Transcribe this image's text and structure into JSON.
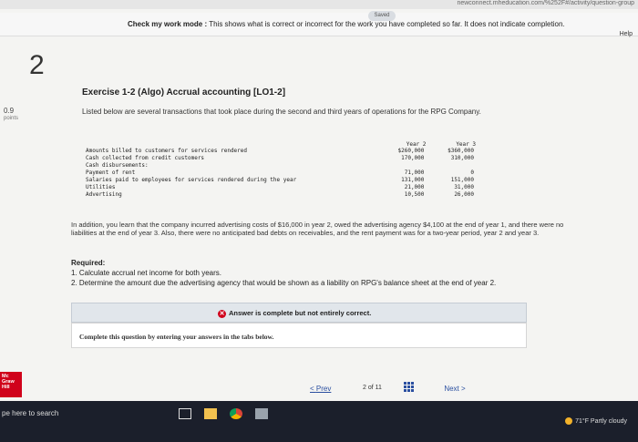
{
  "browser": {
    "url": "newconnect.mheducation.com/%252F#/activity/question-group",
    "saved_label": "Saved",
    "help_label": "Help"
  },
  "banner": {
    "mode_label": "Check my work mode :",
    "message": "This shows what is correct or incorrect for the work you have completed so far. It does not indicate completion."
  },
  "question": {
    "number": "2",
    "points": "0.9",
    "points_label": "points"
  },
  "exercise": {
    "title": "Exercise 1-2 (Algo) Accrual accounting [LO1-2]",
    "intro": "Listed below are several transactions that took place during the second and third years of operations for the RPG Company."
  },
  "transactions": {
    "headers": [
      "",
      "Year 2",
      "Year 3"
    ],
    "rows": [
      {
        "label": "Amounts billed to customers for services rendered",
        "y2": "$260,000",
        "y3": "$360,000"
      },
      {
        "label": "Cash collected from credit customers",
        "y2": "170,000",
        "y3": "310,000"
      },
      {
        "label": "Cash disbursements:",
        "y2": "",
        "y3": ""
      },
      {
        "label": "Payment of rent",
        "y2": "71,000",
        "y3": "0"
      },
      {
        "label": "Salaries paid to employees for services rendered during the year",
        "y2": "131,000",
        "y3": "151,000"
      },
      {
        "label": "Utilities",
        "y2": "21,000",
        "y3": "31,000"
      },
      {
        "label": "Advertising",
        "y2": "10,500",
        "y3": "26,000"
      }
    ]
  },
  "paragraph": "In addition, you learn that the company incurred advertising costs of $16,000 in year 2, owed the advertising agency $4,100 at the end of year 1, and there were no liabilities at the end of year 3. Also, there were no anticipated bad debts on receivables, and the rent payment was for a two-year period, year 2 and year 3.",
  "required": {
    "title": "Required:",
    "items": [
      "1. Calculate accrual net income for both years.",
      "2. Determine the amount due the advertising agency that would be shown as a liability on RPG's balance sheet at the end of year 2."
    ]
  },
  "answer": {
    "status": "Answer is complete but not entirely correct.",
    "instruction": "Complete this question by entering your answers in the tabs below."
  },
  "navigation": {
    "prev_label": "Prev",
    "page_current": "2",
    "page_of": "of",
    "page_total": "11",
    "next_label": "Next"
  },
  "logo": {
    "text": "Mc Graw Hill"
  },
  "taskbar": {
    "search_placeholder": "pe here to search",
    "weather": "71°F  Partly cloudy"
  },
  "colors": {
    "accent": "#2a4fa0",
    "error": "#d0021b",
    "brand": "#d0021b"
  }
}
